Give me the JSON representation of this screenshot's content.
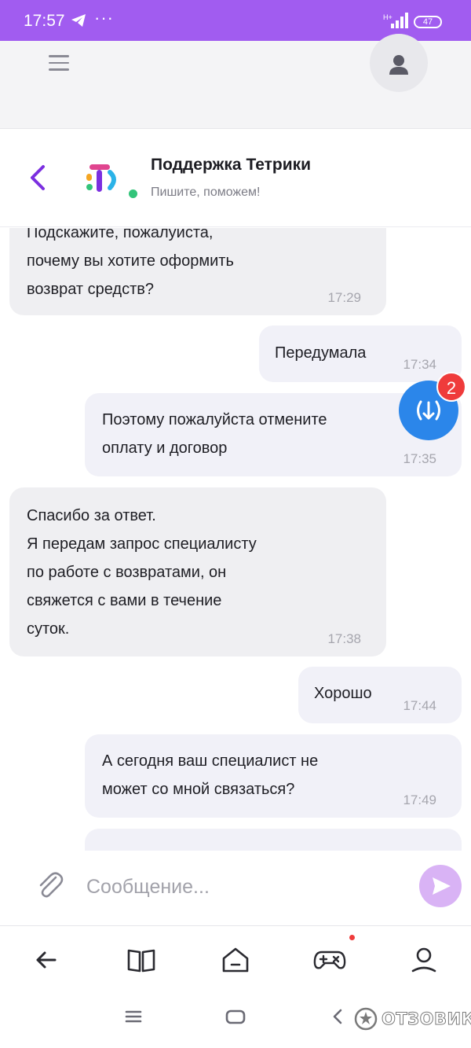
{
  "status_bar": {
    "time": "17:57",
    "more": "···",
    "battery": "47",
    "icons": [
      "telegram-icon",
      "signal-icon",
      "battery-icon"
    ]
  },
  "app_bar": {
    "icons": [
      "menu-icon",
      "user-icon"
    ]
  },
  "chat_header": {
    "title": "Поддержка Тетрики",
    "subtitle": "Пишите, поможем!",
    "online_color": "#33c47a"
  },
  "messages": [
    {
      "side": "in",
      "text": "Подскажите, пожалуйста,\nпочему вы хотите оформить\nвозврат средств?",
      "time": "17:29"
    },
    {
      "side": "out",
      "text": "Передумала",
      "time": "17:34"
    },
    {
      "side": "out",
      "text": "Поэтому пожалуйста отмените\nоплату и договор",
      "time": "17:35"
    },
    {
      "side": "in",
      "text": "Спасибо за ответ.\nЯ передам запрос специалисту\nпо работе с возвратами, он\nсвяжется с вами в течение\nсуток.",
      "time": "17:38"
    },
    {
      "side": "out",
      "text": "Хорошо",
      "time": "17:44"
    },
    {
      "side": "out",
      "text": "А сегодня ваш специалист не\nможет со мной связаться?",
      "time": "17:49"
    }
  ],
  "fab": {
    "badge": "2",
    "icon": "broadcast-download-icon",
    "color": "#2b86ea"
  },
  "composer": {
    "placeholder": "Сообщение...",
    "value": "",
    "icons": [
      "paperclip-icon",
      "send-icon"
    ]
  },
  "bottom_nav": {
    "items": [
      "back-arrow-icon",
      "book-icon",
      "home-icon",
      "gamepad-icon",
      "profile-icon"
    ],
    "accent": "#a15cf0"
  },
  "system_nav": {
    "items": [
      "recents-icon",
      "home-icon",
      "back-icon"
    ],
    "watermark": "ОТЗОВИК"
  }
}
